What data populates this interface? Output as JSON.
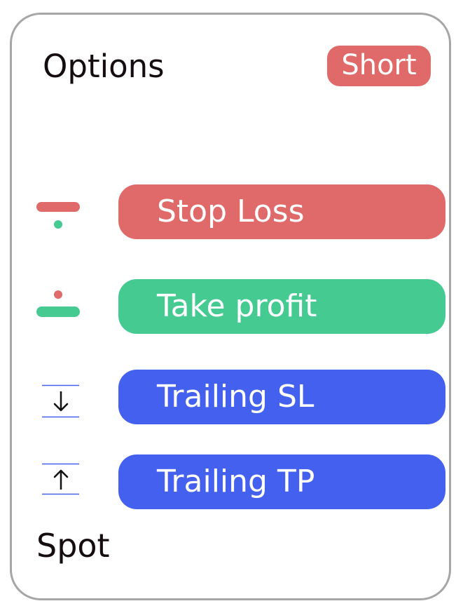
{
  "header": {
    "title": "Options",
    "badge": "Short"
  },
  "actions": [
    {
      "label": "Stop Loss",
      "icon": "stop-loss-icon",
      "color": "#e06a6a"
    },
    {
      "label": "Take profit",
      "icon": "take-profit-icon",
      "color": "#45cb92"
    },
    {
      "label": "Trailing SL",
      "icon": "trailing-down-arrow-icon",
      "color": "#4360ee"
    },
    {
      "label": "Trailing TP",
      "icon": "trailing-up-arrow-icon",
      "color": "#4360ee"
    }
  ],
  "footer": {
    "label": "Spot"
  },
  "colors": {
    "red": "#e06a6a",
    "green": "#45cb92",
    "blue": "#4360ee",
    "border": "#a6a6a6"
  }
}
